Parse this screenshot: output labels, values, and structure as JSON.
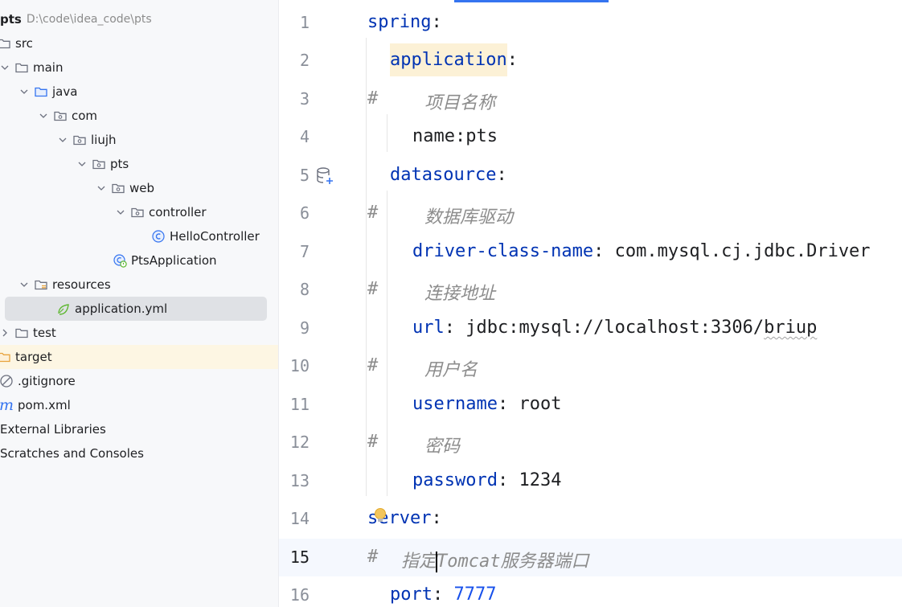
{
  "sidebar": {
    "project": {
      "name": "pts",
      "path": "D:\\code\\idea_code\\pts"
    },
    "items": [
      {
        "label": "src"
      },
      {
        "label": "main"
      },
      {
        "label": "java"
      },
      {
        "label": "com"
      },
      {
        "label": "liujh"
      },
      {
        "label": "pts"
      },
      {
        "label": "web"
      },
      {
        "label": "controller"
      },
      {
        "label": "HelloController"
      },
      {
        "label": "PtsApplication"
      },
      {
        "label": "resources"
      },
      {
        "label": "application.yml"
      },
      {
        "label": "test"
      },
      {
        "label": "target"
      },
      {
        "label": ".gitignore"
      },
      {
        "label": "pom.xml"
      },
      {
        "label": "External Libraries"
      },
      {
        "label": "Scratches and Consoles"
      }
    ]
  },
  "editor": {
    "lines": [
      {
        "n": "1",
        "key": "spring",
        "colon": ":"
      },
      {
        "n": "2",
        "key": "application",
        "colon": ":"
      },
      {
        "n": "3",
        "hash": "#",
        "comment": "项目名称"
      },
      {
        "n": "4",
        "text": "name:pts"
      },
      {
        "n": "5",
        "key": "datasource",
        "colon": ":"
      },
      {
        "n": "6",
        "hash": "#",
        "comment": "数据库驱动"
      },
      {
        "n": "7",
        "key": "driver-class-name",
        "colon": ":",
        "value": " com.mysql.cj.jdbc.Driver"
      },
      {
        "n": "8",
        "hash": "#",
        "comment": "连接地址"
      },
      {
        "n": "9",
        "key": "url",
        "colon": ":",
        "value_a": " jdbc:mysql://localhost:3306/",
        "value_b": "briup"
      },
      {
        "n": "10",
        "hash": "#",
        "comment": "用户名"
      },
      {
        "n": "11",
        "key": "username",
        "colon": ":",
        "value": " root"
      },
      {
        "n": "12",
        "hash": "#",
        "comment": "密码"
      },
      {
        "n": "13",
        "key": "password",
        "colon": ":",
        "value": " 1234"
      },
      {
        "n": "14",
        "key": "server",
        "colon": ":"
      },
      {
        "n": "15",
        "hash": "#",
        "comment_a": "指定",
        "comment_b": "Tomcat服务器端口"
      },
      {
        "n": "16",
        "key": "port",
        "colon": ":",
        "value": " 7777"
      }
    ]
  },
  "icons": {
    "folder": "folder-icon",
    "package": "package-icon",
    "class": "class-icon",
    "spring": "spring-icon",
    "database": "database-add-icon",
    "bulb": "lightbulb-icon"
  },
  "colors": {
    "keyword": "#0033b3",
    "number": "#1750eb",
    "comment": "#8c8c8c",
    "selection": "#dfe1e5",
    "current_line": "#f5f8fe",
    "accent": "#3574f0"
  }
}
